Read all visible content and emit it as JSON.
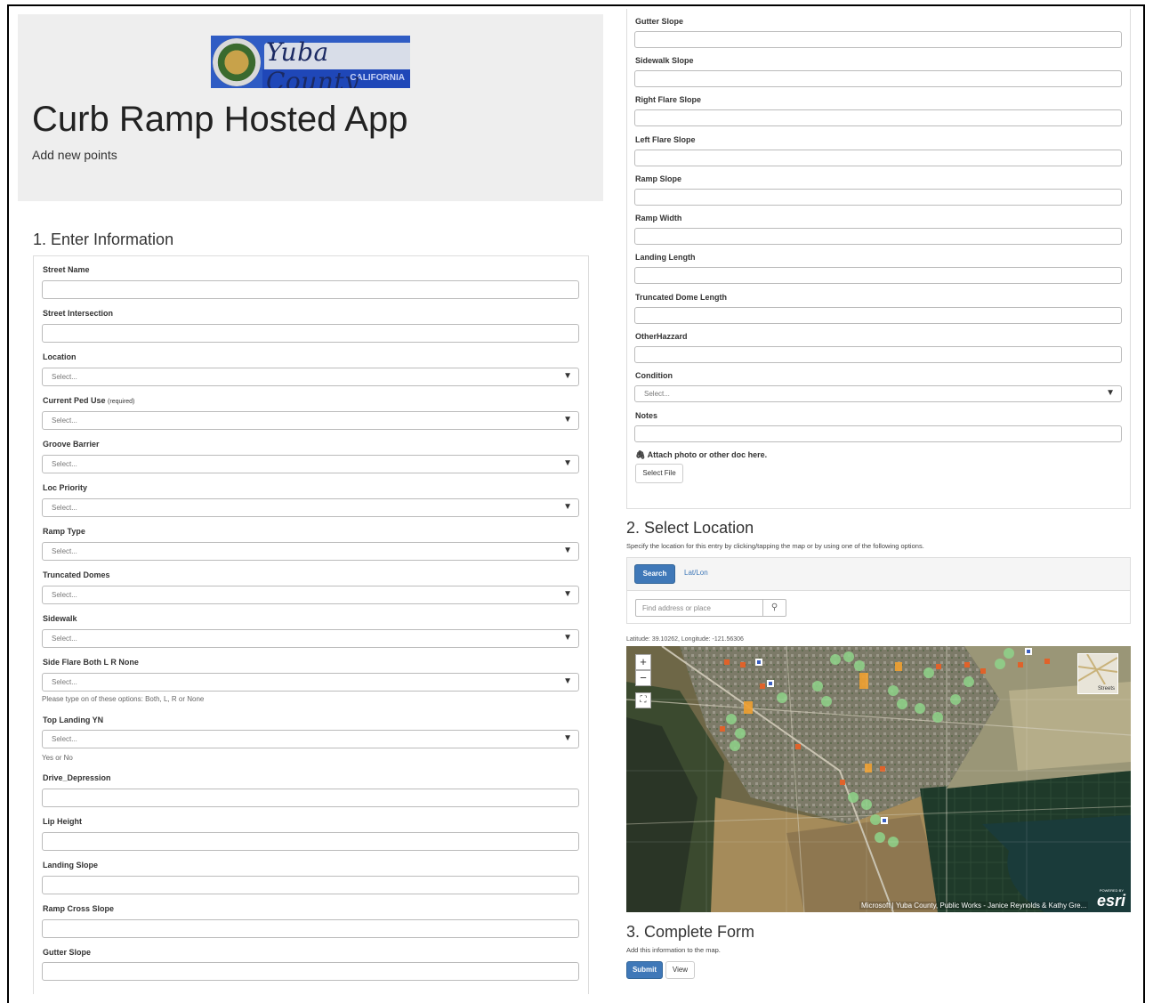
{
  "header": {
    "logo_text": "Yuba County",
    "logo_state": "CALIFORNIA",
    "title": "Curb Ramp Hosted App",
    "subtitle": "Add new points"
  },
  "section1": {
    "heading": "1. Enter Information",
    "fields": {
      "street_name": "Street Name",
      "street_intersection": "Street Intersection",
      "location": "Location",
      "current_ped_use": "Current Ped Use",
      "required": "(required)",
      "groove_barrier": "Groove Barrier",
      "loc_priority": "Loc Priority",
      "ramp_type": "Ramp Type",
      "truncated_domes": "Truncated Domes",
      "sidewalk": "Sidewalk",
      "side_flare": "Side Flare Both L R None",
      "side_flare_help": "Please type on of these options: Both, L, R or None",
      "top_landing": "Top Landing YN",
      "top_landing_help": "Yes or No",
      "drive_depression": "Drive_Depression",
      "lip_height": "Lip Height",
      "landing_slope": "Landing Slope",
      "ramp_cross_slope": "Ramp Cross Slope",
      "gutter_slope": "Gutter Slope"
    },
    "select_placeholder": "Select..."
  },
  "right_fields": {
    "gutter_slope": "Gutter Slope",
    "sidewalk_slope": "Sidewalk Slope",
    "right_flare_slope": "Right Flare Slope",
    "left_flare_slope": "Left Flare Slope",
    "ramp_slope": "Ramp Slope",
    "ramp_width": "Ramp Width",
    "landing_length": "Landing Length",
    "truncated_dome_length": "Truncated Dome Length",
    "other_hazzard": "OtherHazzard",
    "condition": "Condition",
    "notes": "Notes",
    "attach_label": "Attach photo or other doc here.",
    "select_file": "Select File"
  },
  "section2": {
    "heading": "2. Select Location",
    "instructions": "Specify the location for this entry by clicking/tapping the map or by using one of the following options.",
    "tab_search": "Search",
    "tab_latlon": "Lat/Lon",
    "search_placeholder": "Find address or place",
    "coords": "Latitude: 39.10262,  Longitude: -121.56306",
    "basemap_label": "Streets",
    "attribution": "Microsoft | Yuba County, Public Works - Janice Reynolds & Kathy Gre...",
    "esri_powered": "POWERED BY",
    "esri": "esri"
  },
  "section3": {
    "heading": "3. Complete Form",
    "instructions": "Add this information to the map.",
    "submit": "Submit",
    "view": "View"
  }
}
